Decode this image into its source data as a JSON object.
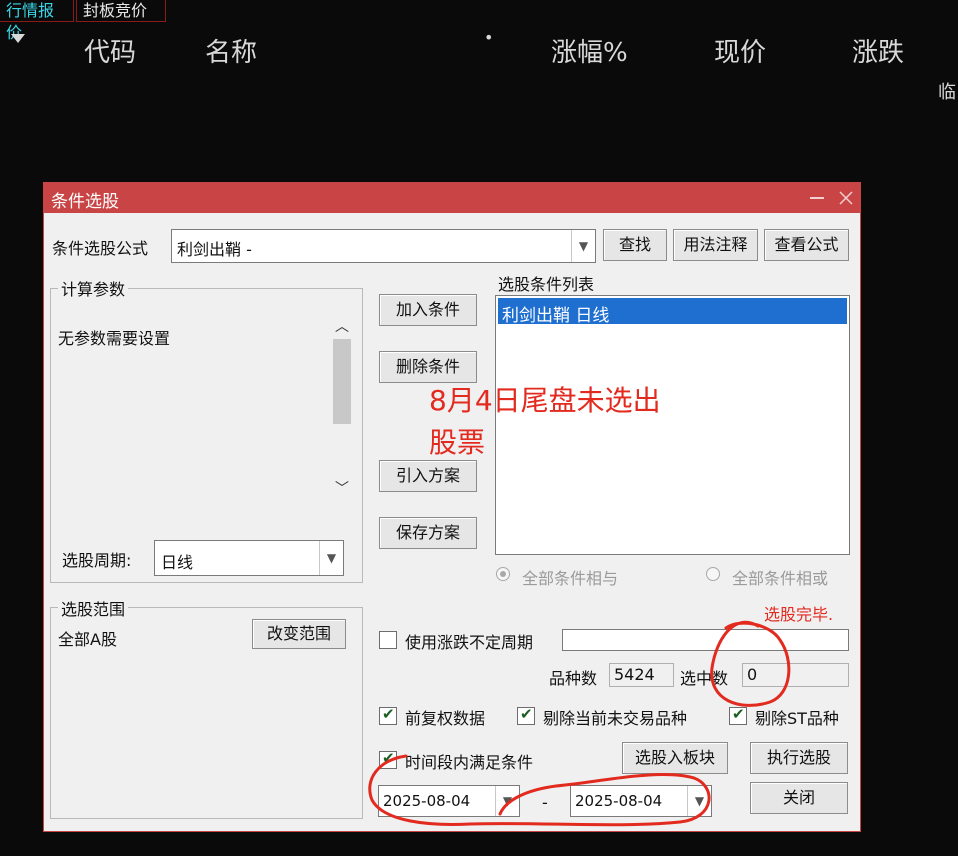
{
  "tabs": [
    "行情报价",
    "封板竞价"
  ],
  "columns": {
    "code": "代码",
    "name": "名称",
    "dot": "•",
    "change_pct": "涨幅%",
    "price": "现价",
    "change": "涨跌",
    "partial_right": "临"
  },
  "dialog": {
    "title": "条件选股",
    "formula_label": "条件选股公式",
    "formula_value": "利剑出鞘  -",
    "find_button": "查找",
    "usage_button": "用法注释",
    "view_formula_button": "查看公式",
    "params_group": "计算参数",
    "no_params_text": "无参数需要设置",
    "period_label": "选股周期:",
    "period_value": "日线",
    "scope_group": "选股范围",
    "scope_value": "全部A股",
    "change_scope_button": "改变范围",
    "add_condition_button": "加入条件",
    "delete_condition_button": "删除条件",
    "import_plan_button": "引入方案",
    "save_plan_button": "保存方案",
    "condition_list_label": "选股条件列表",
    "condition_items": [
      "利剑出鞘  日线"
    ],
    "radio_and": "全部条件相与",
    "radio_or": "全部条件相或",
    "status_text": "选股完毕.",
    "use_variable_period": "使用涨跌不定周期",
    "count_label": "品种数",
    "count_value": "5424",
    "selected_label": "选中数",
    "selected_value": "0",
    "forward_adjust": "前复权数据",
    "exclude_untraded": "剔除当前未交易品种",
    "exclude_st": "剔除ST品种",
    "time_range_check": "时间段内满足条件",
    "to_block_button": "选股入板块",
    "run_button": "执行选股",
    "close_button": "关闭",
    "date_from": "2025-08-04",
    "date_sep": "-",
    "date_to": "2025-08-04"
  },
  "annotation": {
    "line1": "8月4日尾盘未选出",
    "line2": "股票"
  },
  "colors": {
    "title_bar": "#c94545",
    "selection": "#1f6fd0",
    "annotation": "#e22a1f",
    "status": "#e22a1f"
  }
}
